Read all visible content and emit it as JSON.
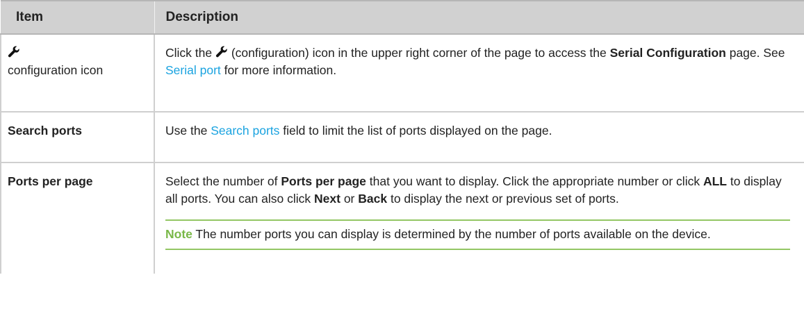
{
  "header": {
    "col_item": "Item",
    "col_description": "Description"
  },
  "rows": [
    {
      "item_icon": "wrench-icon",
      "item_label": "configuration icon",
      "desc": {
        "p1": "Click the",
        "icon": "wrench-icon",
        "p2": " (configuration) icon in the upper right corner of the page to access the",
        "bold": "Serial Configuration",
        "p3": " page. See ",
        "link": "Serial port",
        "p4": " for more information."
      }
    },
    {
      "item_label": "Search ports",
      "desc": {
        "p1": "Use the ",
        "link": "Search ports",
        "p2": " field to limit the list of ports displayed on the page."
      }
    },
    {
      "item_label": "Ports per page",
      "desc": {
        "p1": "Select the number of ",
        "bold1": "Ports per page",
        "p2": " that you want to display. Click the appropriate number or click ",
        "bold2": "ALL",
        "p3": " to display all ports. You can also click ",
        "bold3": "Next",
        "p4": " or ",
        "bold4": "Back",
        "p5": " to display the next or previous set of ports."
      },
      "note": {
        "label": "Note",
        "text": " The number ports you can display is determined by the number of ports available on the device."
      }
    }
  ],
  "colors": {
    "header_bg": "#d1d1d1",
    "link": "#1aa3e0",
    "note_label": "#79b848",
    "note_rule": "#93c664"
  }
}
